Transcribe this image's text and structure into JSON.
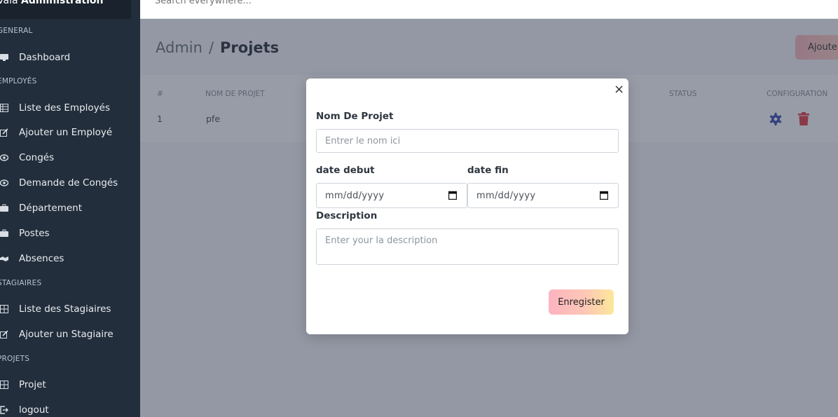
{
  "brand": {
    "prefix": "Vala ",
    "bold": "Administration"
  },
  "sidebar": {
    "sections": [
      {
        "title": "GENERAL"
      },
      {
        "title": "EMPLOYÉS"
      },
      {
        "title": "STAGIAIRES"
      },
      {
        "title": "PROJETS"
      }
    ],
    "items": [
      {
        "label": "Dashboard",
        "icon": "monitor-icon"
      },
      {
        "label": "Liste des Employés",
        "icon": "table-icon"
      },
      {
        "label": "Ajouter un Employé",
        "icon": "edit-icon"
      },
      {
        "label": "Congés",
        "icon": "eye-icon"
      },
      {
        "label": "Demande de Congés",
        "icon": "eye-icon"
      },
      {
        "label": "Département",
        "icon": "briefcase-icon"
      },
      {
        "label": "Postes",
        "icon": "briefcase-icon"
      },
      {
        "label": "Absences",
        "icon": "handshake-icon"
      },
      {
        "label": "Liste des Stagiaires",
        "icon": "table-icon"
      },
      {
        "label": "Ajouter un Stagiaire",
        "icon": "edit-icon"
      },
      {
        "label": "Projet",
        "icon": "table-icon"
      },
      {
        "label": "logout",
        "icon": "logout-icon"
      }
    ]
  },
  "topbar": {
    "search_placeholder": "Search everywhere..."
  },
  "breadcrumb": {
    "parent": "Admin",
    "separator": "/",
    "current": "Projets"
  },
  "add_button": {
    "label": "Ajouter"
  },
  "table": {
    "headers": {
      "id": "#",
      "name": "NOM DE PROJET",
      "status": "STATUS",
      "config": "CONFIGURATION"
    },
    "rows": [
      {
        "id": "1",
        "name": "pfe"
      }
    ]
  },
  "modal": {
    "close": "×",
    "project_name_label": "Nom De Projet",
    "project_name_placeholder": "Entrer le nom ici",
    "start_label": "date debut",
    "start_value": "mm/dd/yyyy",
    "end_label": "date fin",
    "end_value": "mm/dd/yyyy",
    "description_label": "Description",
    "description_placeholder": "Enter your la description",
    "save_label": "Enregister"
  },
  "colors": {
    "sidebar_bg": "#222e3c",
    "accent_icon": "#3f51b5",
    "delete_icon": "#e5424d"
  }
}
